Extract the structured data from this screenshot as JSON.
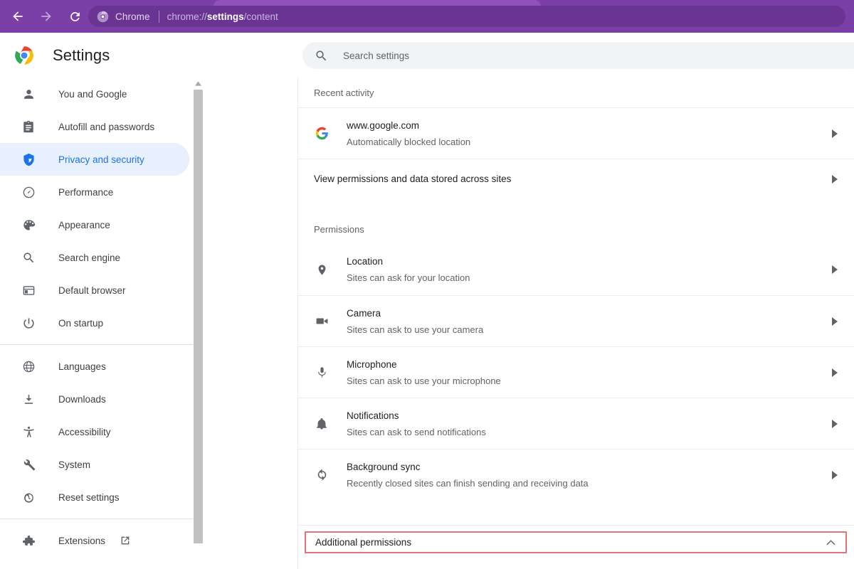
{
  "browser": {
    "back_label": "back-arrow",
    "forward_label": "forward-arrow",
    "reload_label": "reload",
    "omnibox_source": "Chrome",
    "omnibox_url_prefix": "chrome://",
    "omnibox_url_bold": "settings",
    "omnibox_url_suffix": "/content",
    "toolbar_color": "#7b3fa8",
    "tab_color": "#8e52ba"
  },
  "header": {
    "title": "Settings",
    "logo": "chrome-logo"
  },
  "search": {
    "placeholder": "Search settings",
    "icon": "search-icon"
  },
  "sidebar": {
    "groups": [
      {
        "items": [
          {
            "label": "You and Google",
            "icon": "person-icon",
            "selected": false
          },
          {
            "label": "Autofill and passwords",
            "icon": "clipboard-icon",
            "selected": false
          },
          {
            "label": "Privacy and security",
            "icon": "shield-icon",
            "selected": true
          },
          {
            "label": "Performance",
            "icon": "speedometer-icon",
            "selected": false
          },
          {
            "label": "Appearance",
            "icon": "palette-icon",
            "selected": false
          },
          {
            "label": "Search engine",
            "icon": "magnifier-icon",
            "selected": false
          },
          {
            "label": "Default browser",
            "icon": "browser-window-icon",
            "selected": false
          },
          {
            "label": "On startup",
            "icon": "power-icon",
            "selected": false
          }
        ]
      },
      {
        "items": [
          {
            "label": "Languages",
            "icon": "globe-icon",
            "selected": false
          },
          {
            "label": "Downloads",
            "icon": "download-icon",
            "selected": false
          },
          {
            "label": "Accessibility",
            "icon": "accessibility-icon",
            "selected": false
          },
          {
            "label": "System",
            "icon": "wrench-icon",
            "selected": false
          },
          {
            "label": "Reset settings",
            "icon": "history-icon",
            "selected": false
          }
        ]
      },
      {
        "items": [
          {
            "label": "Extensions",
            "icon": "puzzle-icon",
            "selected": false,
            "external": true
          }
        ]
      }
    ],
    "selected_accent": "#1a73e8",
    "selected_background": "#e8f0fe"
  },
  "main": {
    "recent_activity": {
      "heading": "Recent activity",
      "site": {
        "name": "www.google.com",
        "detail": "Automatically blocked location",
        "icon": "google-favicon"
      }
    },
    "view_permissions_label": "View permissions and data stored across sites",
    "permissions": {
      "heading": "Permissions",
      "items": [
        {
          "title": "Location",
          "subtitle": "Sites can ask for your location",
          "icon": "location-pin-icon"
        },
        {
          "title": "Camera",
          "subtitle": "Sites can ask to use your camera",
          "icon": "camera-icon"
        },
        {
          "title": "Microphone",
          "subtitle": "Sites can ask to use your microphone",
          "icon": "microphone-icon"
        },
        {
          "title": "Notifications",
          "subtitle": "Sites can ask to send notifications",
          "icon": "bell-icon"
        },
        {
          "title": "Background sync",
          "subtitle": "Recently closed sites can finish sending and receiving data",
          "icon": "sync-icon"
        }
      ]
    },
    "additional_permissions": {
      "label": "Additional permissions",
      "icon": "chevron-up-icon",
      "highlight_color": "#e57373"
    }
  }
}
